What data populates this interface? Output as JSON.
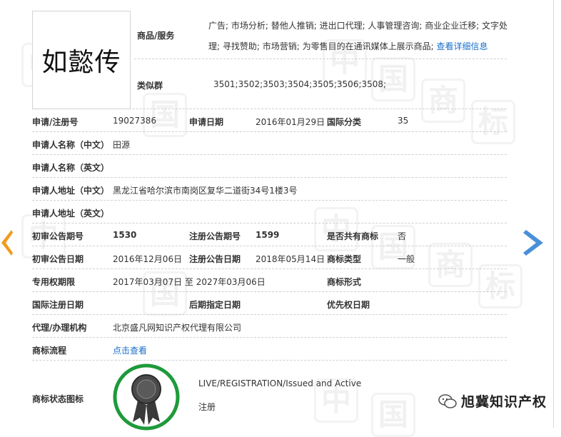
{
  "trademark": {
    "logo_text": "如懿传",
    "goods_label": "商品/服务",
    "goods_line1": "广告; 市场分析; 替他人推销; 进出口代理; 人事管理咨询; 商业企业迁移; 文字处",
    "goods_line2": "理; 寻找赞助; 市场营销; 为零售目的在通讯媒体上展示商品;",
    "goods_more": "查看详细信息",
    "similar_label": "类似群",
    "similar_value": "3501;3502;3503;3504;3505;3506;3508;"
  },
  "fields": {
    "app_no_label": "申请/注册号",
    "app_no": "19027386",
    "app_date_label": "申请日期",
    "app_date": "2016年01月29日",
    "intl_class_label": "国际分类",
    "intl_class": "35",
    "applicant_cn_label": "申请人名称（中文）",
    "applicant_cn": "田源",
    "applicant_en_label": "申请人名称（英文）",
    "address_cn_label": "申请人地址（中文）",
    "address_cn": "黑龙江省哈尔滨市南岗区复华二道街34号1楼3号",
    "address_en_label": "申请人地址（英文）",
    "prelim_no_label": "初审公告期号",
    "prelim_no": "1530",
    "reg_no_label": "注册公告期号",
    "reg_no": "1599",
    "shared_label": "是否共有商标",
    "shared": "否",
    "prelim_date_label": "初审公告日期",
    "prelim_date": "2016年12月06日",
    "reg_date_label": "注册公告日期",
    "reg_date": "2018年05月14日",
    "type_label": "商标类型",
    "type": "一般",
    "exclusive_label": "专用权期限",
    "exclusive": "2017年03月07日 至 2027年03月06日",
    "form_label": "商标形式",
    "intl_reg_date_label": "国际注册日期",
    "later_date_label": "后期指定日期",
    "priority_label": "优先权日期",
    "agent_label": "代理/办理机构",
    "agent": "北京盛凡网知识产权代理有限公司",
    "process_label": "商标流程",
    "process_link": "点击查看",
    "status_label": "商标状态图标",
    "status_en": "LIVE/REGISTRATION/Issued and Active",
    "status_cn": "注册"
  },
  "watermark_char": "商",
  "wechat_account": "旭冀知识产权",
  "colors": {
    "link": "#1a6fc9",
    "arrow_left": "#f39a1e",
    "arrow_right": "#4a90d9",
    "seal_ring": "#1e9a3a"
  }
}
